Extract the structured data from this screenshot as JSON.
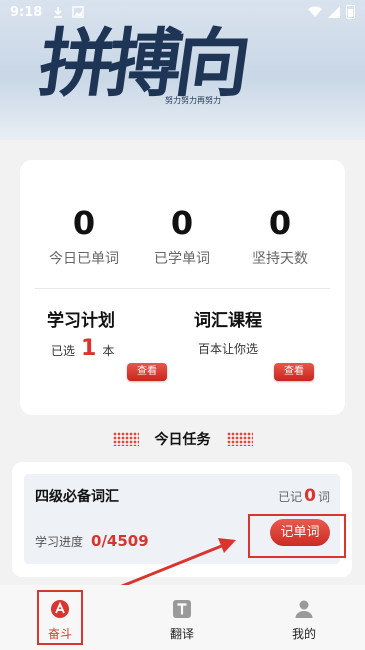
{
  "status_bar": {
    "time": "9:18"
  },
  "hero": {
    "calligraphy": "拼搏向上",
    "subtitle": "努力努力再努力"
  },
  "stats": [
    {
      "value": "0",
      "label": "今日已单词"
    },
    {
      "value": "0",
      "label": "已学单词"
    },
    {
      "value": "0",
      "label": "坚持天数"
    }
  ],
  "plan": {
    "title": "学习计划",
    "prefix": "已选",
    "count": "1",
    "suffix": "本",
    "button": "查看"
  },
  "course": {
    "title": "词汇课程",
    "desc": "百本让你选",
    "button": "查看"
  },
  "today_task": {
    "title": "今日任务"
  },
  "task": {
    "book": "四级必备词汇",
    "remember_prefix": "已记",
    "remember_count": "0",
    "remember_suffix": "词",
    "progress_label": "学习进度",
    "progress_value": "0/4509",
    "button": "记单词"
  },
  "nav": [
    {
      "label": "奋斗",
      "icon": "fendou-icon"
    },
    {
      "label": "翻译",
      "icon": "translate-icon"
    },
    {
      "label": "我的",
      "icon": "user-icon"
    }
  ],
  "colors": {
    "accent": "#d9352e",
    "text": "#111111",
    "muted": "#666666"
  }
}
